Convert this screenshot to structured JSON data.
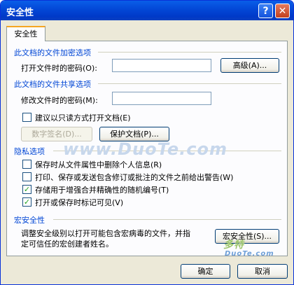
{
  "window": {
    "title": "安全性"
  },
  "titlebar_buttons": {
    "help": "?",
    "close": "✕"
  },
  "tab": {
    "label": "安全性"
  },
  "encryption": {
    "section_title": "此文档的文件加密选项",
    "open_password_label": "打开文件时的密码(O):",
    "open_password_value": "",
    "advanced_button": "高级(A)..."
  },
  "sharing": {
    "section_title": "此文档的文件共享选项",
    "modify_password_label": "修改文件时的密码(M):",
    "modify_password_value": "",
    "readonly_checkbox": {
      "label": "建议以只读方式打开文档(E)",
      "checked": false
    },
    "digital_signature_button": "数字签名(D)...",
    "protect_document_button": "保护文档(P)..."
  },
  "privacy": {
    "section_title": "隐私选项",
    "options": [
      {
        "label": "保存时从文件属性中删除个人信息(R)",
        "checked": false
      },
      {
        "label": "打印、保存或发送包含修订或批注的文件之前给出警告(W)",
        "checked": false
      },
      {
        "label": "存储用于增强合并精确性的随机编号(T)",
        "checked": true
      },
      {
        "label": "打开或保存时标记可见(V)",
        "checked": true
      }
    ]
  },
  "macro": {
    "section_title": "宏安全性",
    "description_line1": "调整安全级别以打开可能包含宏病毒的文件，并指",
    "description_line2": "定可信任的宏创建者姓名。",
    "button": "宏安全性(S)..."
  },
  "footer": {
    "ok_button": "确定",
    "cancel_button": "取消"
  },
  "watermarks": {
    "center": "www.DuoTe.com",
    "logo": "多特",
    "corner": "DuoTe.com"
  }
}
